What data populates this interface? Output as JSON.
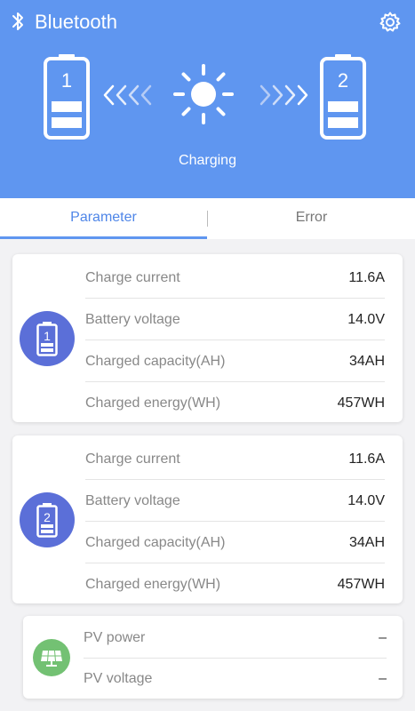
{
  "header": {
    "title": "Bluetooth",
    "battery_left_label": "1",
    "battery_right_label": "2",
    "status": "Charging",
    "bg_color": "#5f96f0"
  },
  "tabs": [
    {
      "label": "Parameter",
      "active": true
    },
    {
      "label": "Error",
      "active": false
    }
  ],
  "battery1": {
    "badge_label": "1",
    "rows": [
      {
        "label": "Charge current",
        "value": "11.6A"
      },
      {
        "label": "Battery voltage",
        "value": "14.0V"
      },
      {
        "label": "Charged capacity(AH)",
        "value": "34AH"
      },
      {
        "label": "Charged energy(WH)",
        "value": "457WH"
      }
    ]
  },
  "battery2": {
    "badge_label": "2",
    "rows": [
      {
        "label": "Charge current",
        "value": "11.6A"
      },
      {
        "label": "Battery voltage",
        "value": "14.0V"
      },
      {
        "label": "Charged capacity(AH)",
        "value": "34AH"
      },
      {
        "label": "Charged energy(WH)",
        "value": "457WH"
      }
    ]
  },
  "pv": {
    "icon": "solar-panel-icon",
    "rows": [
      {
        "label": "PV power",
        "value": "–"
      },
      {
        "label": "PV voltage",
        "value": "–"
      }
    ]
  },
  "icons": {
    "bluetooth": "bluetooth-icon",
    "settings": "gear-icon",
    "sun": "sun-icon",
    "battery": "battery-icon"
  }
}
